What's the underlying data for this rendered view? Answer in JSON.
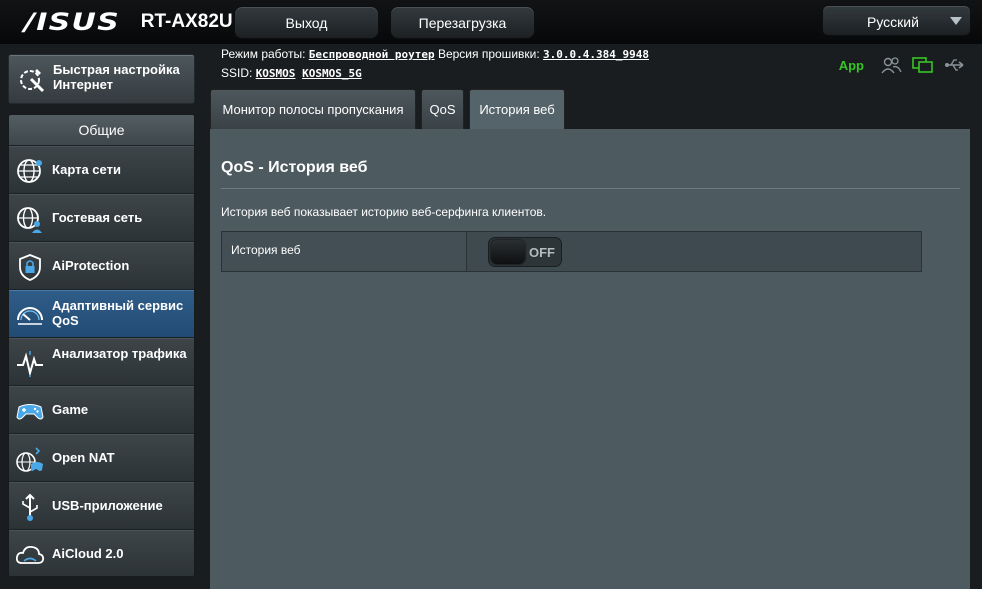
{
  "header": {
    "brand": "/ISUS",
    "model": "RT-AX82U",
    "logout_label": "Выход",
    "reboot_label": "Перезагрузка",
    "language": "Русский"
  },
  "info": {
    "mode_label": "Режим работы:",
    "mode_value": "Беспроводной роутер",
    "firmware_label": "Версия прошивки:",
    "firmware_value": "3.0.0.4.384_9948",
    "ssid_label": "SSID:",
    "ssid_1": "KOSMOS",
    "ssid_2": "KOSMOS_5G",
    "app_label": "App"
  },
  "sidebar": {
    "quick_setup": "Быстрая настройка Интернет",
    "section_title": "Общие",
    "items": [
      {
        "label": "Карта сети",
        "icon": "globe-network-icon"
      },
      {
        "label": "Гостевая сеть",
        "icon": "guest-network-icon"
      },
      {
        "label": "AiProtection",
        "icon": "shield-lock-icon"
      },
      {
        "label": "Адаптивный сервис QoS",
        "icon": "speedometer-icon",
        "active": true
      },
      {
        "label": "Анализатор трафика",
        "icon": "traffic-analyzer-icon"
      },
      {
        "label": "Game",
        "icon": "gamepad-icon"
      },
      {
        "label": "Open NAT",
        "icon": "open-nat-icon"
      },
      {
        "label": "USB-приложение",
        "icon": "usb-app-icon"
      },
      {
        "label": "AiCloud 2.0",
        "icon": "cloud-icon"
      }
    ]
  },
  "tabs": [
    {
      "label": "Монитор полосы пропускания"
    },
    {
      "label": "QoS"
    },
    {
      "label": "История веб",
      "active": true
    }
  ],
  "panel": {
    "title": "QoS - История веб",
    "description": "История веб показывает историю веб-серфинга клиентов.",
    "setting_label": "История веб",
    "toggle_state": "OFF"
  },
  "colors": {
    "accent_active": "#2a5a86",
    "app_green": "#37c526",
    "panel_bg": "#4d5a5f"
  }
}
